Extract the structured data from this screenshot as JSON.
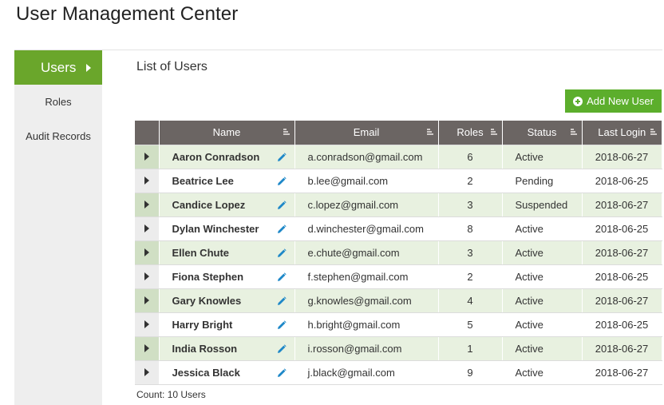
{
  "app": {
    "title": "User Management Center"
  },
  "sidebar": {
    "items": [
      {
        "label": "Users",
        "active": true
      },
      {
        "label": "Roles",
        "active": false
      },
      {
        "label": "Audit Records",
        "active": false
      }
    ]
  },
  "main": {
    "title": "List of Users",
    "add_button_label": "Add New User",
    "count_label": "Count: 10 Users"
  },
  "table": {
    "columns": [
      "Name",
      "Email",
      "Roles",
      "Status",
      "Last Login"
    ],
    "rows": [
      {
        "name": "Aaron Conradson",
        "email": "a.conradson@gmail.com",
        "roles": "6",
        "status": "Active",
        "last_login": "2018-06-27"
      },
      {
        "name": "Beatrice Lee",
        "email": "b.lee@gmail.com",
        "roles": "2",
        "status": "Pending",
        "last_login": "2018-06-25"
      },
      {
        "name": "Candice Lopez",
        "email": "c.lopez@gmail.com",
        "roles": "3",
        "status": "Suspended",
        "last_login": "2018-06-27"
      },
      {
        "name": "Dylan Winchester",
        "email": "d.winchester@gmail.com",
        "roles": "8",
        "status": "Active",
        "last_login": "2018-06-25"
      },
      {
        "name": "Ellen Chute",
        "email": "e.chute@gmail.com",
        "roles": "3",
        "status": "Active",
        "last_login": "2018-06-27"
      },
      {
        "name": "Fiona Stephen",
        "email": "f.stephen@gmail.com",
        "roles": "2",
        "status": "Active",
        "last_login": "2018-06-25"
      },
      {
        "name": "Gary Knowles",
        "email": "g.knowles@gmail.com",
        "roles": "4",
        "status": "Active",
        "last_login": "2018-06-27"
      },
      {
        "name": "Harry Bright",
        "email": "h.bright@gmail.com",
        "roles": "5",
        "status": "Active",
        "last_login": "2018-06-25"
      },
      {
        "name": "India Rosson",
        "email": "i.rosson@gmail.com",
        "roles": "1",
        "status": "Active",
        "last_login": "2018-06-27"
      },
      {
        "name": "Jessica Black",
        "email": "j.black@gmail.com",
        "roles": "9",
        "status": "Active",
        "last_login": "2018-06-27"
      }
    ]
  },
  "icons": {
    "expand": "triangle-right-icon",
    "edit": "pencil-icon",
    "sort": "sort-icon",
    "add": "plus-circle-icon",
    "active_nav": "triangle-right-icon"
  },
  "colors": {
    "accent": "#6aa62b",
    "button": "#5cae2c",
    "header_bg": "#6b6563",
    "row_alt": "#e8f1e0",
    "pencil": "#1e88c8"
  }
}
